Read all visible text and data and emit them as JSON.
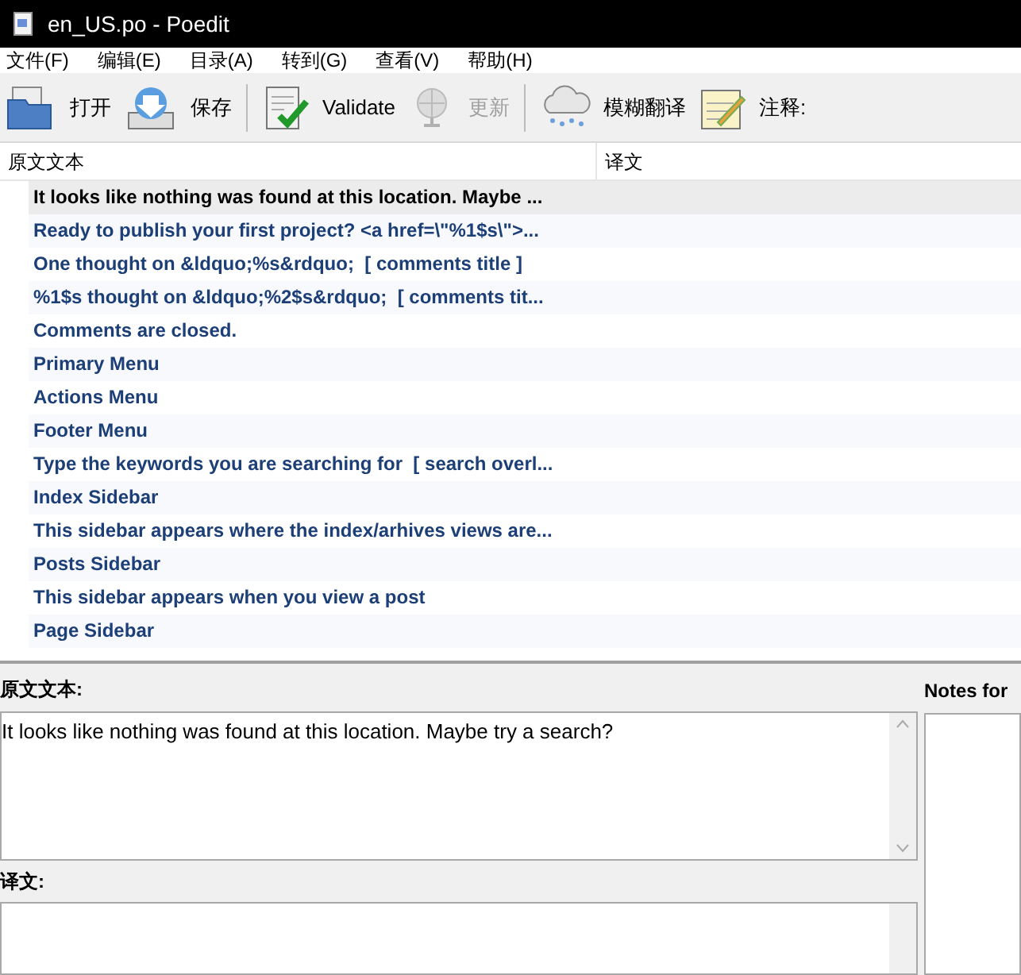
{
  "window": {
    "title": "en_US.po - Poedit"
  },
  "menu": [
    "文件(F)",
    "编辑(E)",
    "目录(A)",
    "转到(G)",
    "查看(V)",
    "帮助(H)"
  ],
  "toolbar": [
    {
      "kind": "open",
      "label": "打开",
      "disabled": false
    },
    {
      "kind": "save",
      "label": "保存",
      "disabled": false,
      "separator_after": true
    },
    {
      "kind": "validate",
      "label": "Validate",
      "disabled": false
    },
    {
      "kind": "update",
      "label": "更新",
      "disabled": true,
      "separator_after": true
    },
    {
      "kind": "fuzzy",
      "label": "模糊翻译",
      "disabled": false
    },
    {
      "kind": "notes",
      "label": "注释:",
      "disabled": false
    }
  ],
  "table": {
    "columns": [
      "原文文本",
      "译文"
    ],
    "rows": [
      {
        "source": "It looks like nothing was found at this location. Maybe ...",
        "selected": true
      },
      {
        "source": "Ready to publish your first project? <a href=\\\"%1$s\\\">...",
        "selected": false
      },
      {
        "source": "One thought on &ldquo;%s&rdquo;  [ comments title ]",
        "selected": false
      },
      {
        "source": "%1$s thought on &ldquo;%2$s&rdquo;  [ comments tit...",
        "selected": false
      },
      {
        "source": "Comments are closed.",
        "selected": false
      },
      {
        "source": "Primary Menu",
        "selected": false
      },
      {
        "source": "Actions Menu",
        "selected": false
      },
      {
        "source": "Footer Menu",
        "selected": false
      },
      {
        "source": "Type the keywords you are searching for  [ search overl...",
        "selected": false
      },
      {
        "source": "Index Sidebar",
        "selected": false
      },
      {
        "source": "This sidebar appears where the index/arhives views are...",
        "selected": false
      },
      {
        "source": "Posts Sidebar",
        "selected": false
      },
      {
        "source": "This sidebar appears when you view a post",
        "selected": false
      },
      {
        "source": "Page Sidebar",
        "selected": false
      }
    ]
  },
  "editor": {
    "source_label": "原文文本:",
    "source_text": "It looks like nothing was found at this location. Maybe try a search?",
    "translation_label": "译文:"
  },
  "notes": {
    "label": "Notes for"
  }
}
